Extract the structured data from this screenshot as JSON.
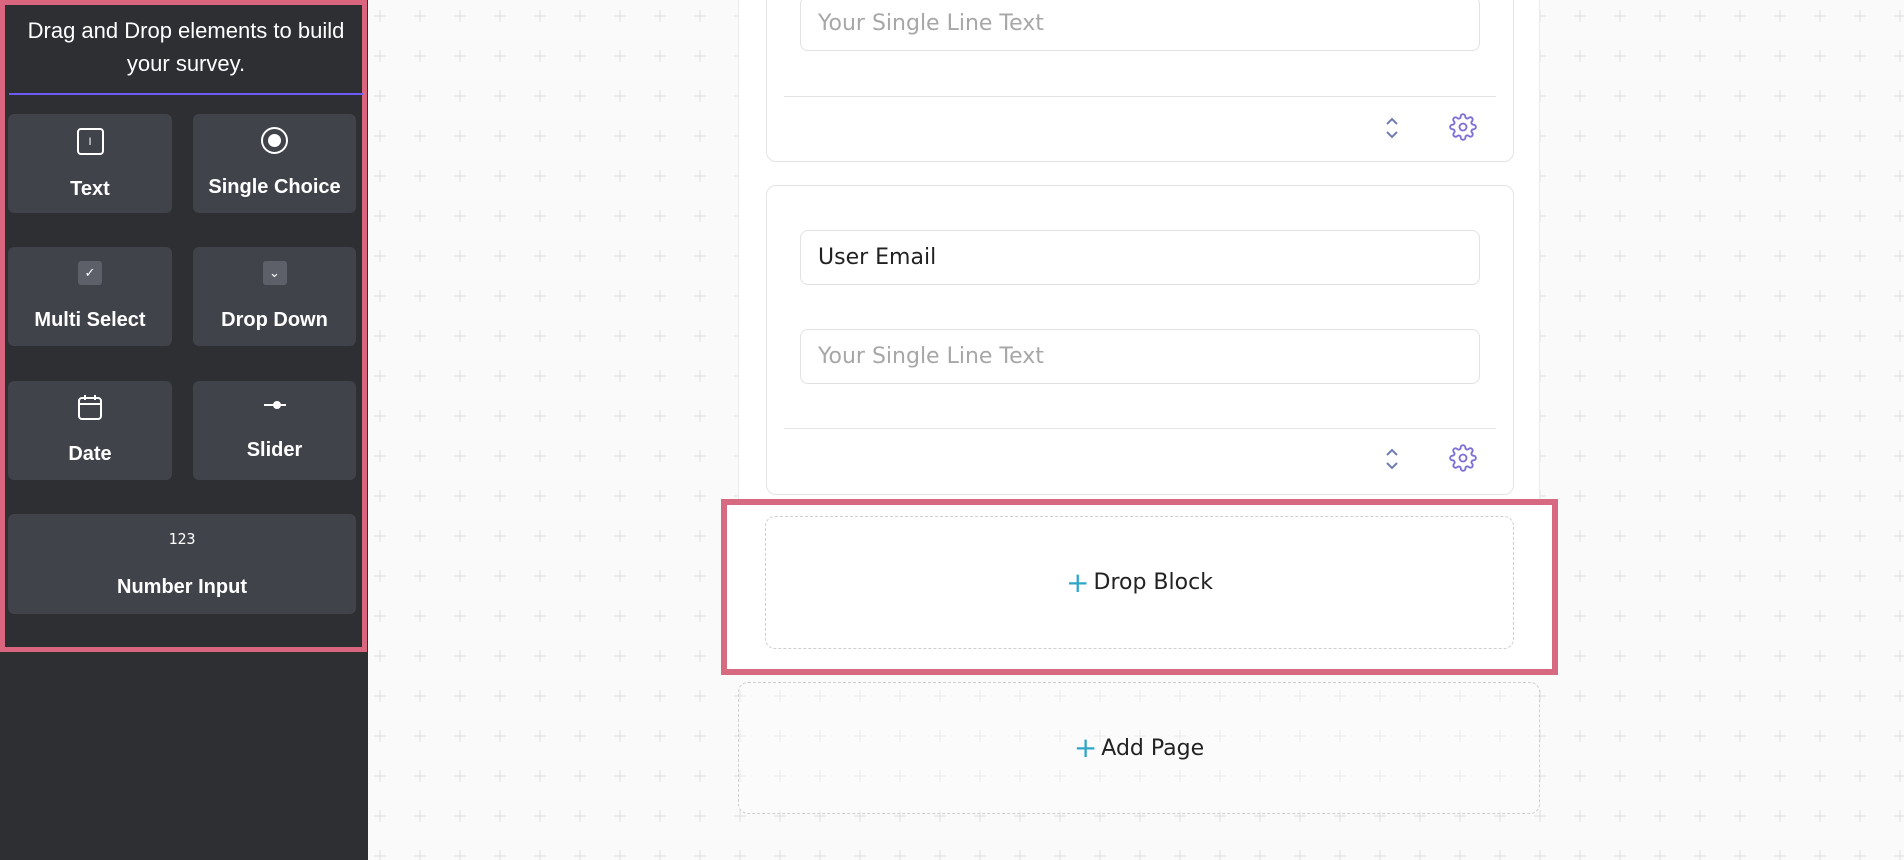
{
  "sidebar": {
    "title": "Drag and Drop elements to build your survey.",
    "elements": [
      {
        "label": "Text",
        "icon": "text-field-icon",
        "glyph": "I"
      },
      {
        "label": "Single Choice",
        "icon": "radio-icon"
      },
      {
        "label": "Multi Select",
        "icon": "checkbox-icon",
        "glyph": "✓"
      },
      {
        "label": "Drop Down",
        "icon": "dropdown-icon",
        "glyph": "⌄"
      },
      {
        "label": "Date",
        "icon": "calendar-icon"
      },
      {
        "label": "Slider",
        "icon": "slider-icon"
      },
      {
        "label": "Number Input",
        "icon": "number-icon",
        "glyph": "123"
      }
    ]
  },
  "canvas": {
    "blocks": [
      {
        "question_value": "",
        "answer_placeholder": "Your Single Line Text"
      },
      {
        "question_value": "User Email",
        "answer_placeholder": "Your Single Line Text"
      }
    ],
    "drop_block_label": "Drop Block",
    "add_page_label": "Add Page",
    "plus_glyph": "+"
  },
  "colors": {
    "sidebar_bg": "#2d2f33",
    "tile_bg": "#40434a",
    "highlight": "#d9667e",
    "accent_line": "#6b5bf7",
    "plus": "#2fa6c8",
    "icon_purple": "#7c6fd6"
  }
}
